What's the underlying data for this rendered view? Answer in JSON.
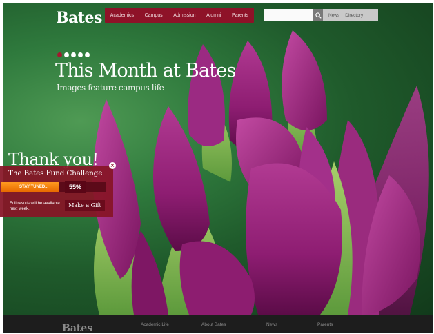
{
  "header": {
    "logo": "Bates",
    "nav": [
      "Academics",
      "Campus",
      "Admission",
      "Alumni",
      "Parents"
    ],
    "search": {
      "value": "",
      "placeholder": ""
    },
    "utility_links": [
      "News",
      "Directory"
    ]
  },
  "hero": {
    "slide_count": 5,
    "active_slide": 1,
    "title": "This Month at Bates",
    "subtitle": "Images feature campus life"
  },
  "fund_panel": {
    "thank_you": "Thank you!",
    "title": "The Bates Fund Challenge",
    "progress_label": "STAY TUNED...",
    "progress_fraction": 0.55,
    "percent": "55%",
    "note": "Full results will be available next week.",
    "gift_button": "Make a Gift",
    "close": "×"
  },
  "footer": {
    "logo": "Bates",
    "links": [
      "Academic Life",
      "About Bates",
      "News",
      "Parents"
    ]
  },
  "colors": {
    "brand_red": "#8e1228",
    "progress_orange": "#f08a10",
    "footer_bg": "#1d1d1d"
  }
}
